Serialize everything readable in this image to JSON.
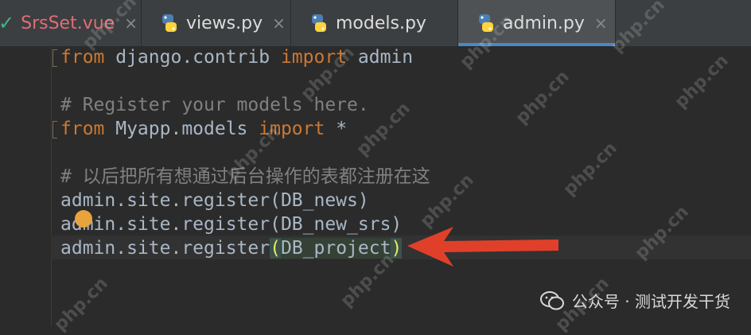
{
  "tabs": [
    {
      "label": "SrsSet.vue",
      "icon": "vue-check-icon",
      "active": false
    },
    {
      "label": "views.py",
      "icon": "python-icon",
      "active": false
    },
    {
      "label": "models.py",
      "icon": "python-icon",
      "active": false
    },
    {
      "label": "admin.py",
      "icon": "python-icon",
      "active": true
    }
  ],
  "tab_close_glyph": "×",
  "code": {
    "line1": {
      "kw1": "from",
      "mid": " django.contrib ",
      "kw2": "import",
      "end": " admin"
    },
    "line3": {
      "comment": "# Register your models here."
    },
    "line4": {
      "kw1": "from",
      "mid": " Myapp.models ",
      "kw2": "import",
      "end": " *"
    },
    "line6": {
      "comment": "# 以后把所有想通过后台操作的表都注册在这"
    },
    "line7": {
      "text": "admin.site.register(DB_news)"
    },
    "line8": {
      "text": "admin.site.register(DB_new_srs)"
    },
    "line9": {
      "prefix": "admin.site.register",
      "open": "(",
      "arg": "DB_project",
      "close": ")"
    }
  },
  "watermark_text": "php.cn",
  "wechat": {
    "label": "公众号 · 测试开发干货"
  },
  "colors": {
    "keyword": "#cc7832",
    "comment": "#808080",
    "default": "#a9b7c6",
    "arrow": "#e0402a",
    "tab_active_underline": "#4a88c7"
  }
}
